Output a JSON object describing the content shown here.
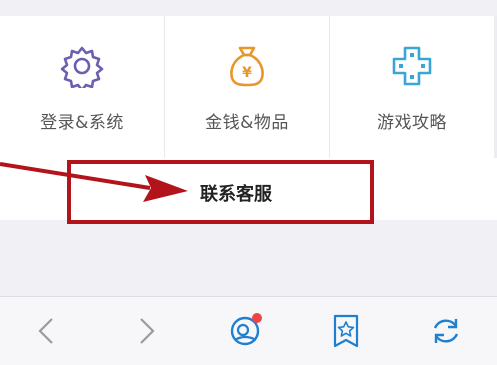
{
  "categories": [
    {
      "label": "登录&系统",
      "icon": "gear-icon",
      "color": "#6a5fb0"
    },
    {
      "label": "金钱&物品",
      "icon": "money-bag-icon",
      "color": "#e8962a"
    },
    {
      "label": "游戏攻略",
      "icon": "gamepad-icon",
      "color": "#3aa6d8"
    }
  ],
  "contact": {
    "label": "联系客服"
  },
  "annotation": {
    "color": "#b3131b"
  },
  "toolbar": {
    "back": "back-icon",
    "forward": "forward-icon",
    "chat": "chat-icon",
    "bookmark": "bookmark-star-icon",
    "refresh": "refresh-icon"
  }
}
